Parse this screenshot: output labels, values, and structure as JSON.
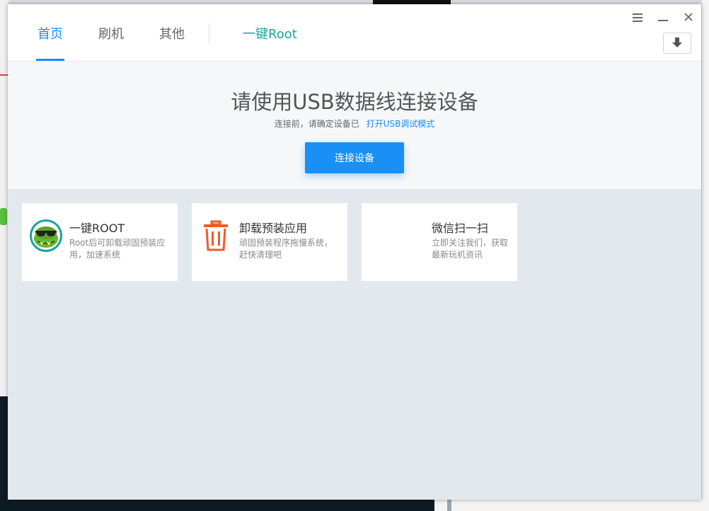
{
  "tabs": [
    {
      "label": "首页",
      "active": true
    },
    {
      "label": "刷机",
      "active": false
    },
    {
      "label": "其他",
      "active": false
    }
  ],
  "root_tab": {
    "label": "一键Root"
  },
  "window_controls": {
    "menu_icon": "menu-icon",
    "minimize_icon": "minimize-icon",
    "close_icon": "close-icon",
    "download_icon": "download-arrow-icon"
  },
  "hero": {
    "title": "请使用USB数据线连接设备",
    "subtitle": "连接前，请确定设备已",
    "link": "打开USB调试模式",
    "button": "连接设备"
  },
  "cards": [
    {
      "title": "一键ROOT",
      "desc": "Root后可卸载顽固预装应用，加速系统",
      "icon": "croc-sunglasses-icon"
    },
    {
      "title": "卸载预装应用",
      "desc": "顽固预装程序拖慢系统，赶快清理吧",
      "icon": "trash-icon"
    },
    {
      "title": "微信扫一扫",
      "desc": "立即关注我们，获取最新玩机资讯",
      "icon": "qr-placeholder"
    }
  ],
  "colors": {
    "accent": "#1a8cff",
    "root": "#18a6a0",
    "trash": "#f05a28",
    "button": "#1990f5"
  }
}
